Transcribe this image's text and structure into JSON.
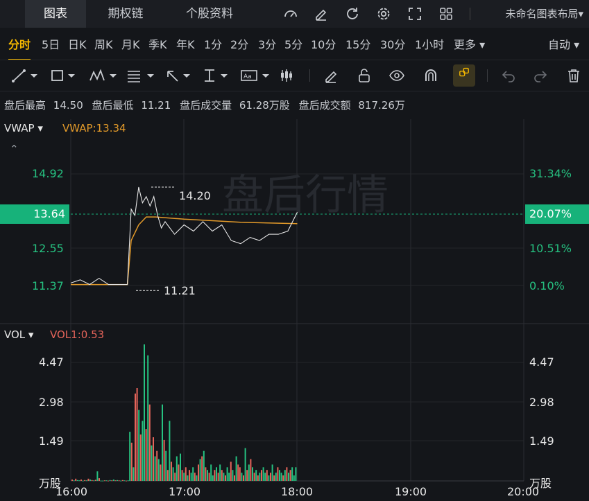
{
  "tabs": [
    {
      "label": "图表",
      "active": true
    },
    {
      "label": "期权链",
      "active": false
    },
    {
      "label": "个股资料",
      "active": false
    }
  ],
  "layout_name": "未命名图表布局▾",
  "periods": [
    "分时",
    "5日",
    "日K",
    "周K",
    "月K",
    "季K",
    "年K",
    "1分",
    "2分",
    "3分",
    "5分",
    "10分",
    "15分",
    "30分",
    "1小时",
    "更多 ▾"
  ],
  "auto_label": "自动 ▾",
  "after_hours": {
    "high_label": "盘后最高",
    "high_value": "14.50",
    "low_label": "盘后最低",
    "low_value": "11.21",
    "volume_label": "盘后成交量",
    "volume_value": "61.28万股",
    "amount_label": "盘后成交额",
    "amount_value": "817.26万"
  },
  "watermark": "盘后行情",
  "price_panel": {
    "indicator_name": "VWAP ▾",
    "indicator_value": "VWAP:13.34",
    "current_price": "13.64",
    "current_pct": "20.07%",
    "left_ticks": [
      "14.92",
      "12.55",
      "11.37"
    ],
    "right_ticks": [
      "31.34%",
      "10.51%",
      "0.10%"
    ],
    "max_annotation": "14.20",
    "min_annotation": "11.21"
  },
  "volume_panel": {
    "indicator_name": "VOL ▾",
    "indicator_value": "VOL1:0.53",
    "left_ticks": [
      "4.47",
      "2.98",
      "1.49"
    ],
    "right_ticks": [
      "4.47",
      "2.98",
      "1.49"
    ],
    "unit_left": "万股",
    "unit_right": "万股"
  },
  "time_axis": [
    "16:00",
    "17:00",
    "18:00",
    "19:00",
    "20:00"
  ],
  "colors": {
    "up": "#e5645a",
    "down": "#26c281",
    "vwap": "#e49b2a",
    "price_line": "#e8e8e8",
    "accent": "#f5b800"
  },
  "chart_data": {
    "type": "line",
    "x_range": [
      "16:00",
      "20:00"
    ],
    "ylim": [
      11.21,
      15.0
    ],
    "price": {
      "x": [
        "16:00",
        "16:05",
        "16:10",
        "16:15",
        "16:20",
        "16:25",
        "16:30",
        "16:32",
        "16:34",
        "16:36",
        "16:38",
        "16:40",
        "16:42",
        "16:44",
        "16:46",
        "16:48",
        "16:50",
        "16:55",
        "17:00",
        "17:05",
        "17:10",
        "17:15",
        "17:20",
        "17:25",
        "17:30",
        "17:35",
        "17:40",
        "17:45",
        "17:50",
        "17:55",
        "18:00"
      ],
      "values": [
        11.45,
        11.55,
        11.4,
        11.6,
        11.4,
        11.4,
        11.4,
        13.8,
        13.6,
        14.5,
        14.0,
        14.2,
        13.9,
        14.2,
        13.6,
        13.2,
        13.4,
        13.0,
        13.3,
        13.1,
        13.4,
        13.1,
        13.3,
        12.8,
        12.7,
        12.9,
        12.8,
        13.0,
        13.0,
        13.1,
        13.7
      ]
    },
    "vwap": {
      "x": [
        "16:00",
        "16:30",
        "16:32",
        "16:36",
        "16:40",
        "16:45",
        "17:00",
        "17:30",
        "18:00"
      ],
      "values": [
        11.4,
        11.4,
        12.8,
        13.3,
        13.55,
        13.55,
        13.48,
        13.38,
        13.34
      ]
    },
    "volume": {
      "unit": "万股",
      "ylim": [
        0,
        5.0
      ],
      "bars": [
        0.05,
        0.02,
        0.08,
        0.03,
        0.02,
        0.05,
        0.01,
        0.03,
        0.02,
        0.08,
        0.05,
        0.03,
        0.02,
        0.04,
        0.35,
        0.1,
        0.01,
        0.01,
        0.02,
        0.02,
        0.01,
        0.03,
        0.02,
        0.05,
        0.02,
        0.03,
        0.02,
        0.01,
        0.03,
        0.02,
        0.01,
        0.02,
        1.8,
        1.4,
        0.5,
        3.2,
        3.4,
        2.6,
        1.7,
        2.2,
        5.0,
        1.9,
        4.6,
        2.8,
        1.3,
        1.6,
        0.9,
        1.1,
        0.8,
        0.6,
        2.8,
        1.5,
        1.1,
        0.4,
        2.2,
        0.7,
        0.5,
        0.3,
        0.9,
        0.6,
        1.0,
        0.4,
        0.3,
        0.5,
        0.2,
        0.4,
        0.3,
        0.5,
        0.3,
        0.2,
        0.6,
        0.8,
        0.9,
        1.1,
        0.5,
        0.4,
        0.3,
        0.6,
        0.2,
        0.4,
        0.5,
        0.3,
        0.6,
        0.4,
        0.3,
        0.2,
        0.5,
        0.3,
        0.7,
        0.4,
        0.2,
        0.9,
        0.6,
        0.5,
        0.3,
        0.2,
        1.2,
        0.4,
        0.6,
        0.8,
        0.5,
        0.3,
        0.4,
        0.2,
        0.3,
        0.4,
        0.5,
        0.3,
        0.4,
        0.2,
        0.3,
        0.6,
        0.2,
        0.3,
        0.5,
        0.4,
        0.3,
        0.2,
        0.4,
        0.5,
        0.3,
        0.4,
        0.5,
        0.2,
        0.5
      ],
      "colors_up": [
        1,
        0,
        1,
        0,
        0,
        1,
        0,
        1,
        0,
        1,
        0,
        1,
        0,
        1,
        0,
        1,
        0,
        0,
        1,
        0,
        1,
        0,
        1,
        0,
        1,
        0,
        1,
        0,
        1,
        0,
        1,
        0,
        0,
        1,
        0,
        1,
        1,
        0,
        1,
        0,
        0,
        1,
        0,
        1,
        0,
        1,
        0,
        1,
        0,
        1,
        0,
        1,
        0,
        1,
        0,
        1,
        0,
        1,
        0,
        1,
        0,
        1,
        0,
        1,
        0,
        1,
        0,
        0,
        1,
        0,
        1,
        0,
        1,
        0,
        1,
        0,
        1,
        0,
        0,
        1,
        0,
        1,
        0,
        1,
        0,
        1,
        0,
        0,
        1,
        0,
        1,
        0,
        1,
        1,
        0,
        1,
        0,
        1,
        0,
        1,
        0,
        1,
        0,
        1,
        0,
        1,
        0,
        0,
        1,
        0,
        1,
        0,
        1,
        0,
        1,
        0,
        0,
        1,
        0,
        1,
        0,
        1,
        0,
        0,
        0
      ]
    }
  }
}
